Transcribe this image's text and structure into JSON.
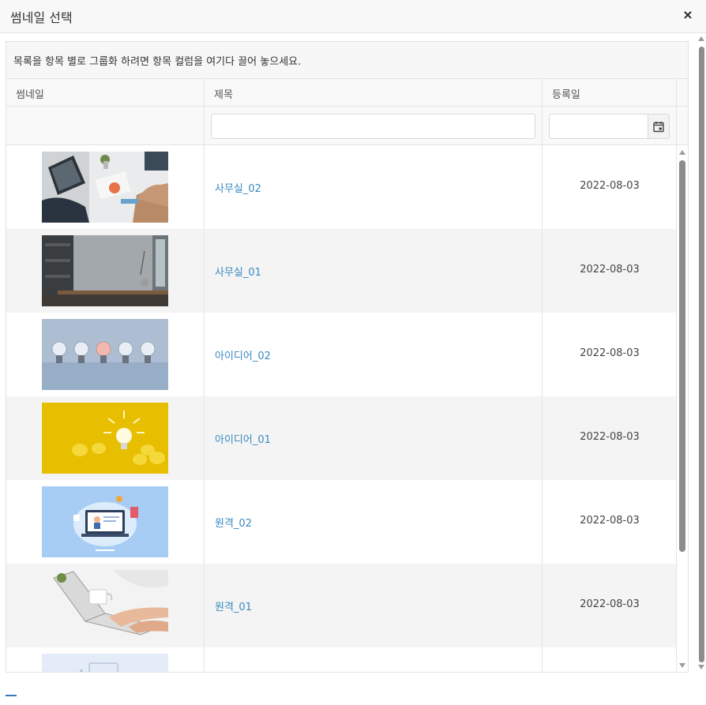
{
  "dialog": {
    "title": "썸네일 선택",
    "close_label": "×"
  },
  "grid": {
    "grouping_hint": "목록을 항목 별로 그룹화 하려면 항목 컬럼을 여기다 끌어 놓으세요.",
    "columns": [
      "썸네일",
      "제목",
      "등록일"
    ],
    "filters": {
      "title_value": "",
      "date_value": ""
    },
    "rows": [
      {
        "title": "사무실_02",
        "date": "2022-08-03",
        "thumbnail": "office-desk-photo"
      },
      {
        "title": "사무실_01",
        "date": "2022-08-03",
        "thumbnail": "office-room-photo"
      },
      {
        "title": "아이디어_02",
        "date": "2022-08-03",
        "thumbnail": "light-bulbs-blue-photo"
      },
      {
        "title": "아이디어_01",
        "date": "2022-08-03",
        "thumbnail": "light-bulbs-yellow-photo"
      },
      {
        "title": "원격_02",
        "date": "2022-08-03",
        "thumbnail": "remote-learning-illustration"
      },
      {
        "title": "원격_01",
        "date": "2022-08-03",
        "thumbnail": "laptop-typing-photo"
      },
      {
        "title": "",
        "date": "",
        "thumbnail": "partial-illustration"
      }
    ]
  },
  "icons": {
    "calendar": "calendar-icon",
    "close": "close-icon"
  },
  "colors": {
    "link": "#3a8ac0",
    "alt_row": "#f4f4f4",
    "header_bg": "#f9f9f9",
    "scroll_thumb": "#8c8c8c"
  }
}
